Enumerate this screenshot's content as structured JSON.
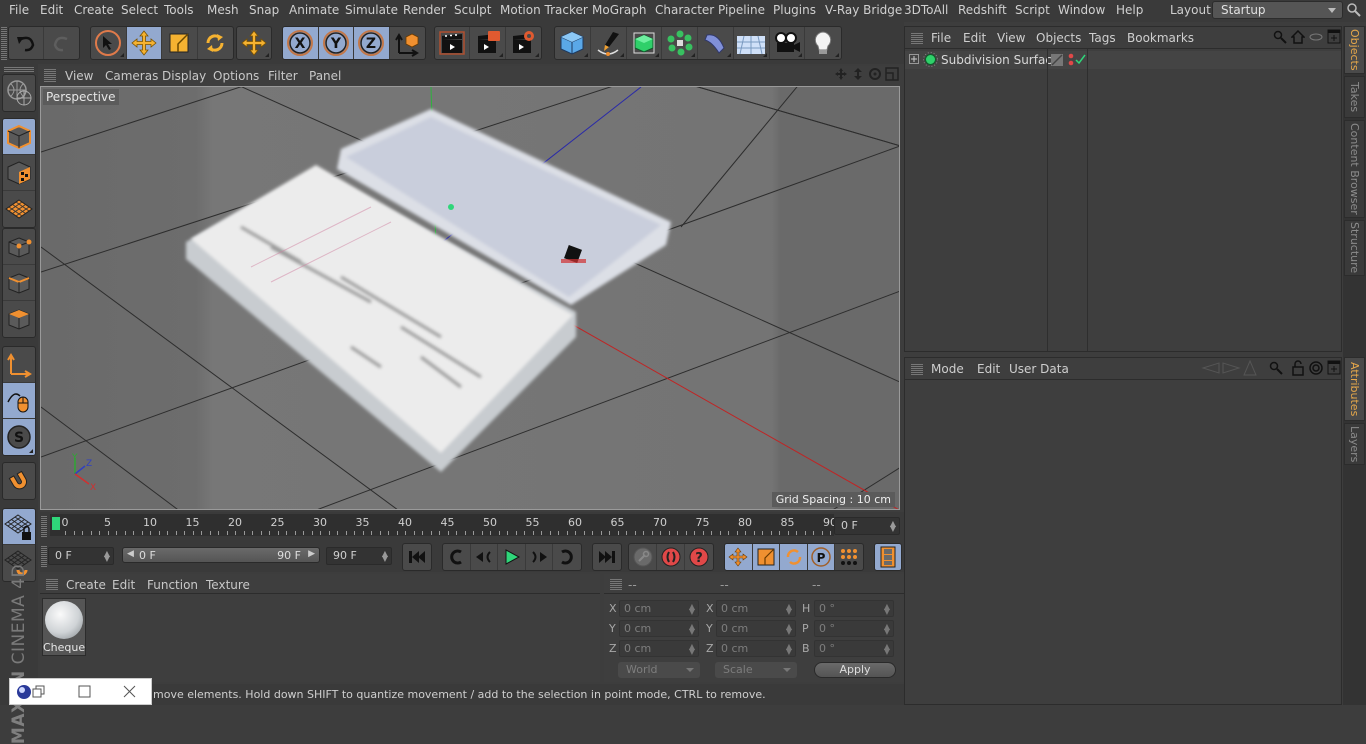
{
  "menubar": {
    "items": [
      "File",
      "Edit",
      "Create",
      "Select",
      "Tools",
      "Mesh",
      "Snap",
      "Animate",
      "Simulate",
      "Render",
      "Sculpt",
      "Motion Tracker",
      "MoGraph",
      "Character",
      "Pipeline",
      "Plugins",
      "V-Ray Bridge",
      "3DToAll",
      "Redshift",
      "Script",
      "Window",
      "Help"
    ],
    "layout_label": "Layout:",
    "layout_value": "Startup"
  },
  "toolbar": {
    "groups": [
      [
        "undo-icon",
        "redo-icon"
      ],
      [
        "live-selection-icon",
        "move-icon",
        "scale-icon",
        "rotate-icon"
      ],
      [
        "recent-tool-icon"
      ],
      [
        "x-axis-lock-icon",
        "y-axis-lock-icon",
        "z-axis-lock-icon",
        "coordinate-system-icon"
      ],
      [
        "render-view-icon",
        "render-to-picture-viewer-icon",
        "render-settings-icon"
      ],
      [
        "cube-icon",
        "pen-icon",
        "subdivision-surface-icon",
        "cloner-icon",
        "deformer-icon",
        "floor-icon",
        "camera-icon",
        "light-icon"
      ]
    ]
  },
  "left_tools": [
    "make-editable-icon",
    "model-mode-icon",
    "texture-mode-icon",
    "workplane-icon",
    "points-mode-icon",
    "edges-mode-icon",
    "polygons-mode-icon",
    "axis-mode-icon",
    "tweak-mode-icon",
    "solo-icon",
    "snap-icon",
    "locked-workplane-icon",
    "planar-workplane-icon"
  ],
  "branding": {
    "maxon": "MAXON",
    "product": "CINEMA 4D"
  },
  "viewport": {
    "menu": [
      "View",
      "Cameras",
      "Display",
      "Options",
      "Filter",
      "Panel"
    ],
    "camera_label": "Perspective",
    "grid_spacing": "Grid Spacing : 10 cm",
    "axis_labels": {
      "x": "X",
      "y": "Y",
      "z": "Z"
    },
    "axis_colors": {
      "x": "#d03030",
      "y": "#2ea832",
      "z": "#3040c0"
    }
  },
  "timeline": {
    "ticks": [
      "0",
      "5",
      "10",
      "15",
      "20",
      "25",
      "30",
      "35",
      "40",
      "45",
      "50",
      "55",
      "60",
      "65",
      "70",
      "75",
      "80",
      "85",
      "90"
    ],
    "current_frame": "0 F",
    "marker_color": "#2fd67a"
  },
  "playback": {
    "start_field": "0 F",
    "range_start": "0 F",
    "range_end": "90 F",
    "end_field": "90 F"
  },
  "material_manager": {
    "menu": [
      "Create",
      "Edit",
      "Function",
      "Texture"
    ],
    "materials": [
      {
        "name": "Cheque"
      }
    ]
  },
  "coordinates": {
    "headers": [
      "--",
      "--",
      "--"
    ],
    "position": {
      "labels": [
        "X",
        "Y",
        "Z"
      ],
      "values": [
        "0 cm",
        "0 cm",
        "0 cm"
      ]
    },
    "size": {
      "labels": [
        "X",
        "Y",
        "Z"
      ],
      "values": [
        "0 cm",
        "0 cm",
        "0 cm"
      ]
    },
    "rotation": {
      "labels": [
        "H",
        "P",
        "B"
      ],
      "values": [
        "0 °",
        "0 °",
        "0 °"
      ]
    },
    "mode_dropdown": "World",
    "size_dropdown": "Scale",
    "apply_label": "Apply"
  },
  "status": {
    "text": "move elements. Hold down SHIFT to quantize movement / add to the selection in point mode, CTRL to remove."
  },
  "object_manager": {
    "menu": [
      "File",
      "Edit",
      "View",
      "Objects",
      "Tags",
      "Bookmarks"
    ],
    "objects": [
      {
        "name": "Subdivision Surface"
      }
    ]
  },
  "attribute_manager": {
    "menu": [
      "Mode",
      "Edit",
      "User Data"
    ]
  },
  "side_tabs": {
    "top": [
      {
        "label": "Objects",
        "active": true
      },
      {
        "label": "Takes",
        "active": false
      },
      {
        "label": "Content Browser",
        "active": false
      },
      {
        "label": "Structure",
        "active": false
      }
    ],
    "bottom": [
      {
        "label": "Attributes",
        "active": true
      },
      {
        "label": "Layers",
        "active": false
      }
    ]
  },
  "colors": {
    "accent_active": "#93a9cf",
    "tab_active_text": "#e7a84a",
    "tool_orange": "#f0a030"
  }
}
